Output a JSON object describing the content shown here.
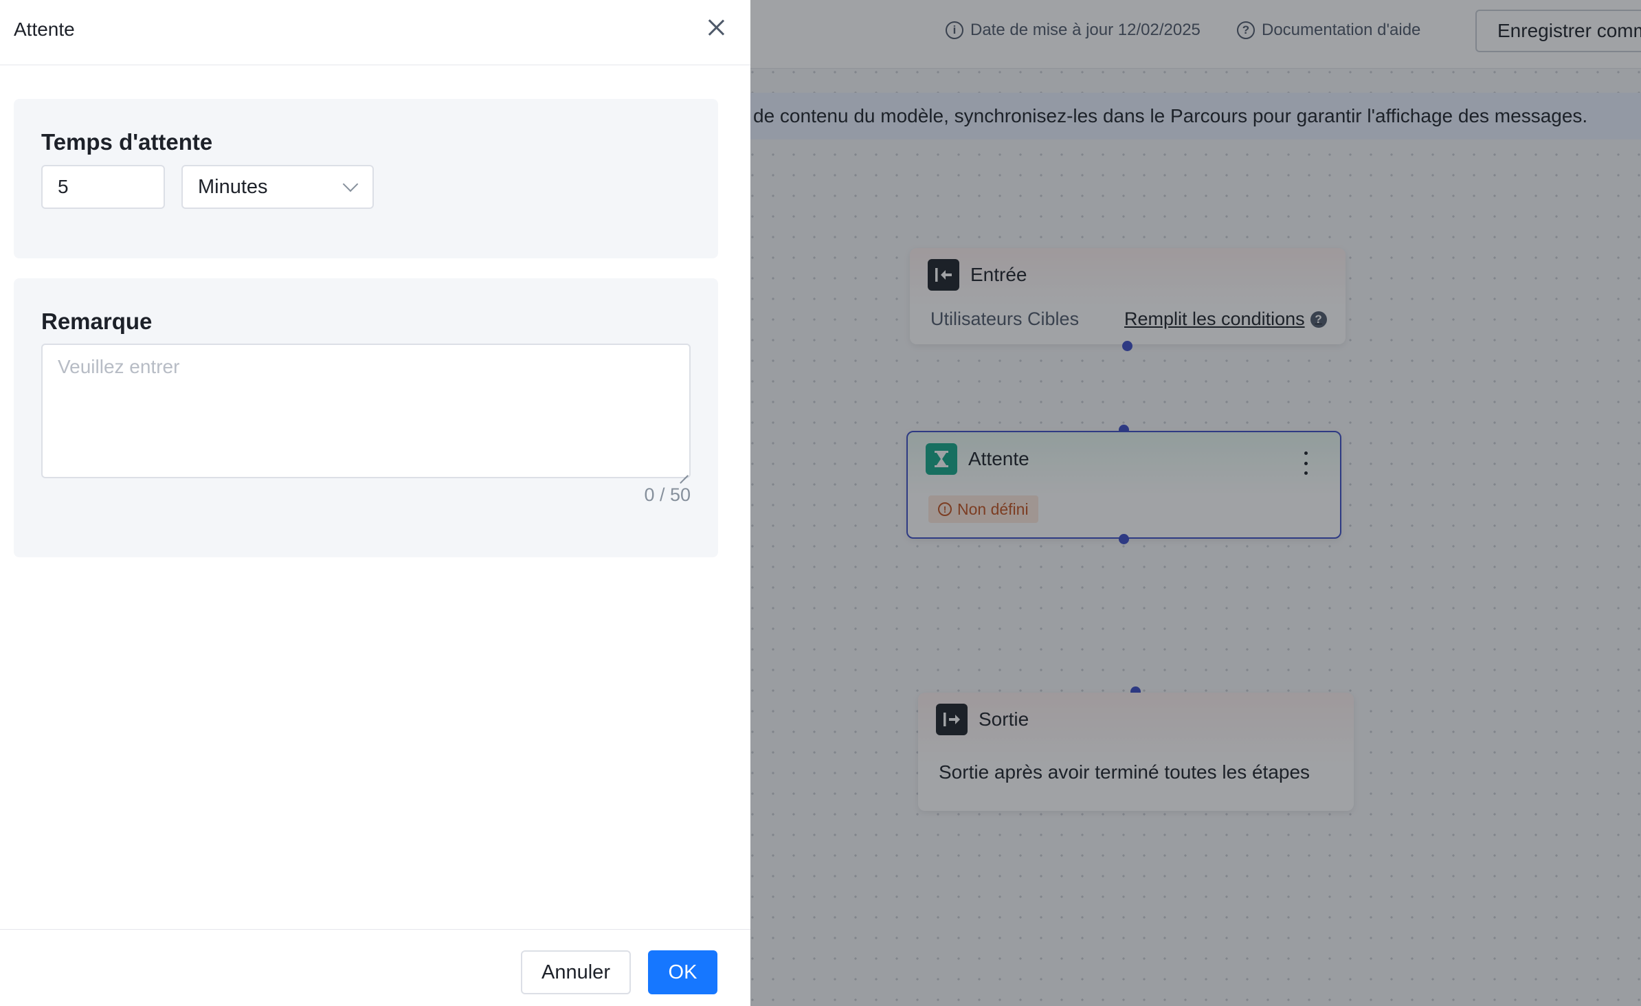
{
  "topbar": {
    "update_date": "Date de mise à jour 12/02/2025",
    "help_doc": "Documentation d'aide",
    "save_label": "Enregistrer comm"
  },
  "banner": {
    "text": "de contenu du modèle, synchronisez-les dans le Parcours pour garantir l'affichage des messages."
  },
  "flow": {
    "entry": {
      "title": "Entrée",
      "target_label": "Utilisateurs Cibles",
      "condition_link": "Remplit les conditions"
    },
    "wait": {
      "title": "Attente",
      "status_badge": "Non défini"
    },
    "exit": {
      "title": "Sortie",
      "description": "Sortie après avoir terminé toutes les étapes"
    }
  },
  "drawer": {
    "title": "Attente",
    "wait_time": {
      "label": "Temps d'attente",
      "value": "5",
      "unit": "Minutes"
    },
    "remark": {
      "label": "Remarque",
      "placeholder": "Veuillez entrer",
      "counter": "0 / 50"
    },
    "footer": {
      "cancel_label": "Annuler",
      "ok_label": "OK"
    }
  },
  "colors": {
    "primary": "#1677ff",
    "selected_border": "#3b4cc4",
    "wait_icon": "#13a889",
    "warning_text": "#c2521f"
  },
  "icons": [
    "info-icon",
    "help-circle-icon",
    "entry-icon",
    "hourglass-icon",
    "exit-icon",
    "more-vertical-icon",
    "close-icon",
    "chevron-down-icon",
    "warning-icon"
  ]
}
